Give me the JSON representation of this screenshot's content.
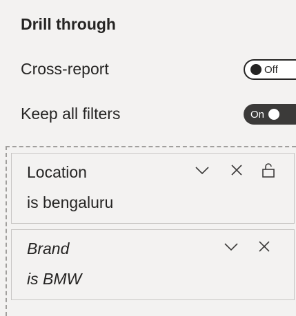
{
  "drill_through": {
    "title": "Drill through",
    "options": [
      {
        "label": "Cross-report",
        "state": "Off"
      },
      {
        "label": "Keep all filters",
        "state": "On"
      }
    ]
  },
  "filters": [
    {
      "field": "Location",
      "condition": "is bengaluru",
      "locked": true
    },
    {
      "field": "Brand",
      "condition": "is BMW",
      "locked": false
    }
  ],
  "icons": {
    "expand": "chevron-down-icon",
    "remove": "close-icon",
    "lock": "lock-icon"
  },
  "colors": {
    "pane_background": "#f3f2f1",
    "toggle_on_background": "#3b3a39",
    "text": "#252423"
  }
}
